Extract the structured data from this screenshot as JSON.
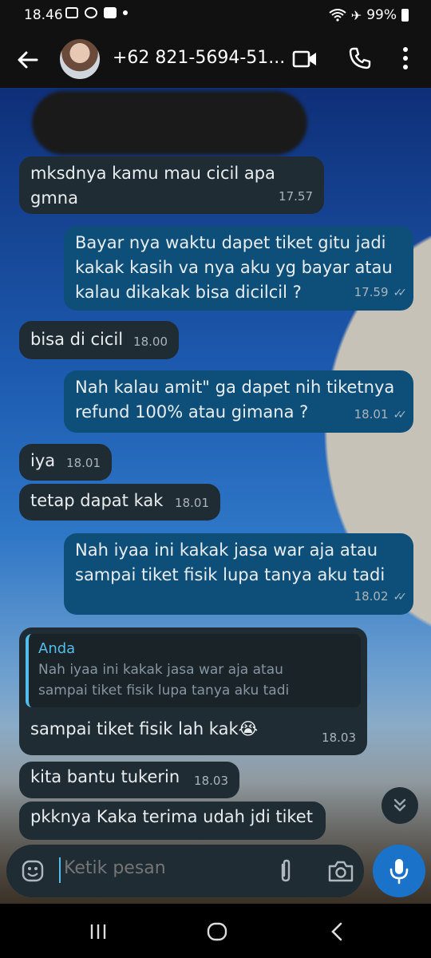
{
  "status": {
    "time": "18.46",
    "battery": "99%"
  },
  "header": {
    "contact": "+62 821-5694-51..."
  },
  "messages": [
    {
      "dir": "in",
      "text": "mksdnya kamu mau cicil apa gmna",
      "time": "17.57"
    },
    {
      "dir": "out",
      "text": "Bayar nya waktu dapet tiket gitu jadi\nkakak kasih va nya aku yg bayar atau\nkalau dikakak bisa dicilcil ?",
      "time": "17.59"
    },
    {
      "dir": "in",
      "text": "bisa di cicil",
      "time": "18.00"
    },
    {
      "dir": "out",
      "text": "Nah kalau amit\" ga dapet nih tiketnya\nrefund 100% atau gimana ?",
      "time": "18.01"
    },
    {
      "dir": "in",
      "text": "iya",
      "time": "18.01"
    },
    {
      "dir": "in",
      "text": "tetap dapat kak",
      "time": "18.01"
    },
    {
      "dir": "out",
      "text": "Nah iyaa ini kakak jasa war aja atau\nsampai tiket fisik lupa tanya aku tadi",
      "time": "18.02"
    },
    {
      "dir": "in",
      "quote_author": "Anda",
      "quote_text": "Nah iyaa ini kakak jasa war aja atau\nsampai tiket fisik lupa tanya aku tadi",
      "text": "sampai tiket fisik lah kak😭",
      "time": "18.03"
    },
    {
      "dir": "in",
      "text": "kita bantu tukerin",
      "time": "18.03"
    },
    {
      "dir": "in",
      "text": "pkknya Kaka terima udah jdi tiket",
      "time": ""
    }
  ],
  "composer": {
    "placeholder": "Ketik pesan"
  },
  "colors": {
    "incoming": "#202c33",
    "outgoing": "#0e4f7a",
    "accent": "#1a73c9"
  },
  "icons": [
    "back-arrow-icon",
    "video-call-icon",
    "phone-icon",
    "more-vert-icon",
    "emoji-icon",
    "attach-icon",
    "camera-icon",
    "mic-icon",
    "scroll-down-icon"
  ]
}
